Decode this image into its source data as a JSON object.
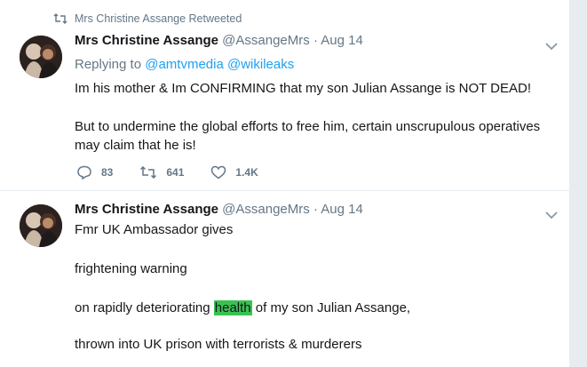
{
  "tweets": [
    {
      "retweet_context": "Mrs Christine Assange Retweeted",
      "name": "Mrs Christine Assange",
      "handle": "@AssangeMrs",
      "separator": "·",
      "date": "Aug 14",
      "replying_label": "Replying to",
      "reply_handles": [
        "@amtvmedia",
        "@wikileaks"
      ],
      "lines": [
        "Im his mother & Im CONFIRMING that my son Julian Assange is NOT DEAD!",
        "But to undermine the global efforts to free him, certain unscrupulous operatives may claim that he is!"
      ],
      "actions": {
        "replies": "83",
        "retweets": "641",
        "likes": "1.4K"
      }
    },
    {
      "name": "Mrs Christine Assange",
      "handle": "@AssangeMrs",
      "separator": "·",
      "date": "Aug 14",
      "lines": [
        "Fmr UK Ambassador gives",
        "frightening warning",
        "on rapidly deteriorating ",
        "health",
        " of my son Julian Assange,",
        "thrown into UK prison with terrorists & murderers"
      ]
    }
  ],
  "colors": {
    "link": "#1da1f2",
    "muted": "#657786",
    "highlight": "#39c252",
    "divider": "#e6ecf0"
  },
  "icons": [
    "retweet-icon",
    "chevron-down-icon",
    "reply-icon",
    "retweet-icon",
    "like-icon"
  ]
}
